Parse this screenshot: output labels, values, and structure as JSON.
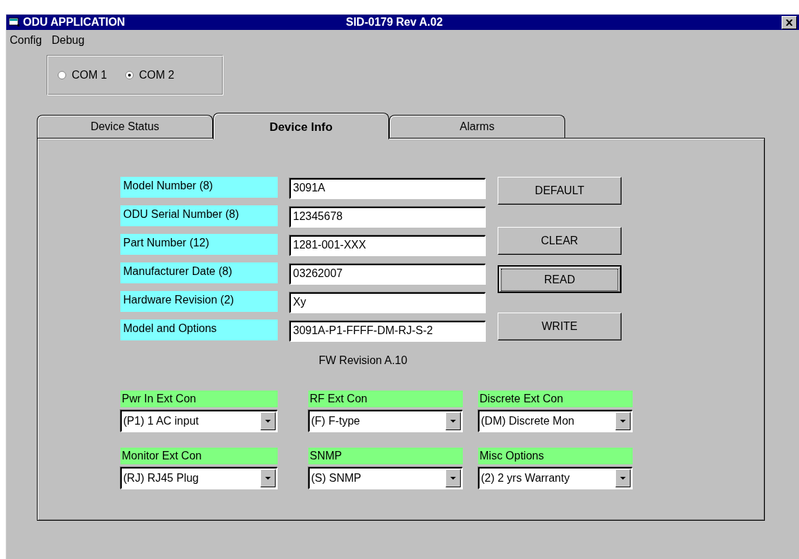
{
  "window": {
    "title": "ODU APPLICATION",
    "subtitle": "SID-0179 Rev A.02"
  },
  "menu": [
    {
      "label": "Config"
    },
    {
      "label": "Debug"
    }
  ],
  "ports": [
    {
      "label": "COM 1",
      "selected": false
    },
    {
      "label": "COM 2",
      "selected": true
    }
  ],
  "tabs": [
    {
      "label": "Device Status",
      "selected": false
    },
    {
      "label": "Device Info",
      "selected": true
    },
    {
      "label": "Alarms",
      "selected": false
    }
  ],
  "fields": [
    {
      "label": "Model Number (8)",
      "value": "3091A"
    },
    {
      "label": "ODU Serial Number (8)",
      "value": "12345678"
    },
    {
      "label": "Part Number (12)",
      "value": "1281-001-XXX"
    },
    {
      "label": "Manufacturer Date (8)",
      "value": "03262007"
    },
    {
      "label": "Hardware Revision (2)",
      "value": "Xy"
    },
    {
      "label": "Model and Options",
      "value": "3091A-P1-FFFF-DM-RJ-S-2"
    }
  ],
  "buttons": [
    {
      "label": "DEFAULT",
      "focused": false
    },
    {
      "label": "CLEAR",
      "focused": false
    },
    {
      "label": "READ",
      "focused": true
    },
    {
      "label": "WRITE",
      "focused": false
    }
  ],
  "fw_revision": "FW Revision  A.10",
  "options": [
    {
      "label": "Pwr In Ext Con",
      "value": "(P1) 1 AC input"
    },
    {
      "label": "RF Ext Con",
      "value": "(F) F-type"
    },
    {
      "label": "Discrete Ext Con",
      "value": "(DM) Discrete Mon"
    },
    {
      "label": "Monitor Ext Con",
      "value": "(RJ) RJ45 Plug"
    },
    {
      "label": "SNMP",
      "value": "(S) SNMP"
    },
    {
      "label": "Misc Options",
      "value": "(2) 2 yrs Warranty"
    }
  ]
}
